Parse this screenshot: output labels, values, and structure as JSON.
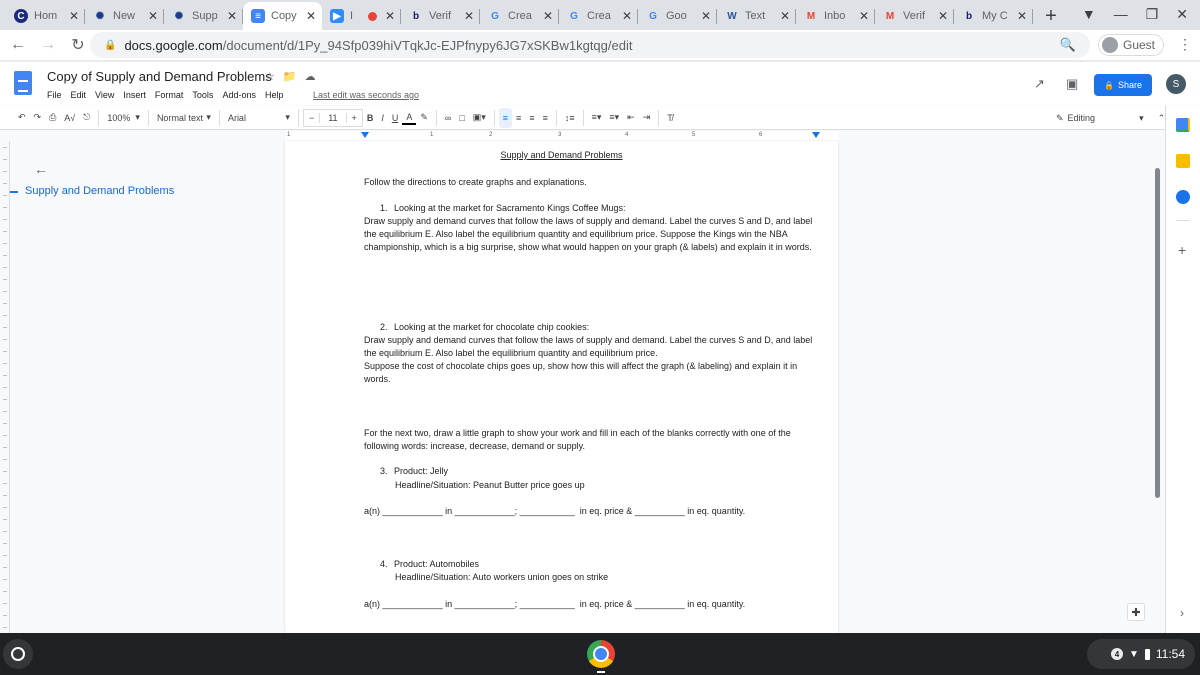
{
  "browser": {
    "tabs": [
      {
        "label": "Hom",
        "icon": "clever-icon",
        "active": false
      },
      {
        "label": "New",
        "icon": "canvas-icon",
        "active": false
      },
      {
        "label": "Supp",
        "icon": "canvas-icon",
        "active": false
      },
      {
        "label": "Copy",
        "icon": "google-docs-icon",
        "active": true
      },
      {
        "label": "I",
        "icon": "zoom-icon",
        "active": false,
        "recording": true
      },
      {
        "label": "Verif",
        "icon": "bartleby-icon",
        "active": false
      },
      {
        "label": "Crea",
        "icon": "google-icon",
        "active": false
      },
      {
        "label": "Crea",
        "icon": "google-icon",
        "active": false
      },
      {
        "label": "Goo",
        "icon": "google-icon",
        "active": false
      },
      {
        "label": "Text",
        "icon": "word-icon",
        "active": false
      },
      {
        "label": "Inbo",
        "icon": "gmail-icon",
        "active": false
      },
      {
        "label": "Verif",
        "icon": "gmail-icon",
        "active": false
      },
      {
        "label": "My C",
        "icon": "bartleby-icon",
        "active": false
      }
    ],
    "new_tab": "+",
    "url_domain": "docs.google.com",
    "url_path": "/document/d/1Py_94Sfp039hiVTqkJc-EJPfnypy6JG7xSKBw1kgtqg/edit",
    "profile": "Guest"
  },
  "docs": {
    "title": "Copy of Supply and Demand Problems",
    "menus": [
      "File",
      "Edit",
      "View",
      "Insert",
      "Format",
      "Tools",
      "Add-ons",
      "Help"
    ],
    "last_edit": "Last edit was seconds ago",
    "share_label": "Share",
    "avatar_initial": "S",
    "toolbar": {
      "zoom": "100%",
      "style": "Normal text",
      "font": "Arial",
      "font_size": "11",
      "mode": "Editing"
    },
    "ruler_numbers": [
      "1",
      "1",
      "2",
      "3",
      "4",
      "5",
      "6"
    ],
    "outline": {
      "heading": "Supply and Demand Problems"
    }
  },
  "document": {
    "title": "Supply and Demand Problems",
    "intro": "Follow the directions to create graphs and explanations.",
    "q1": {
      "number": "1.",
      "heading": "Looking at the market for Sacramento Kings Coffee Mugs:",
      "body": "Draw supply and demand curves that follow the laws of supply and demand.  Label the curves S and D, and label the equilibrium E.  Also label the equilibrium quantity and equilibrium price.  Suppose the Kings win the NBA championship, which is a big surprise, show what would happen on your graph (& labels) and explain it in words."
    },
    "q2": {
      "number": "2.",
      "heading": "Looking at the market for chocolate chip cookies:",
      "body1": "Draw supply and demand curves that follow the laws of supply and demand.  Label the curves S and D, and label the equilibrium E.  Also label the equilibrium quantity and equilibrium price.",
      "body2": "Suppose the cost of chocolate chips goes up, show how this will affect the graph (& labeling) and explain it in words."
    },
    "next_two": "For the next two, draw a little graph to show your work and fill in each of the blanks correctly with one of the following words: increase, decrease, demand or supply.",
    "q3": {
      "number": "3.",
      "product": "Product: Jelly",
      "situation": "Headline/Situation: Peanut Butter price goes up",
      "blanks": "a(n) ____________ in ____________; ___________  in eq. price & __________ in eq. quantity."
    },
    "q4": {
      "number": "4.",
      "product": "Product: Automobiles",
      "situation": "Headline/Situation: Auto workers union goes on strike",
      "blanks": "a(n) ____________ in ____________; ___________  in eq. price & __________ in eq. quantity."
    }
  },
  "shelf": {
    "notification_count": "4",
    "time": "11:54"
  }
}
